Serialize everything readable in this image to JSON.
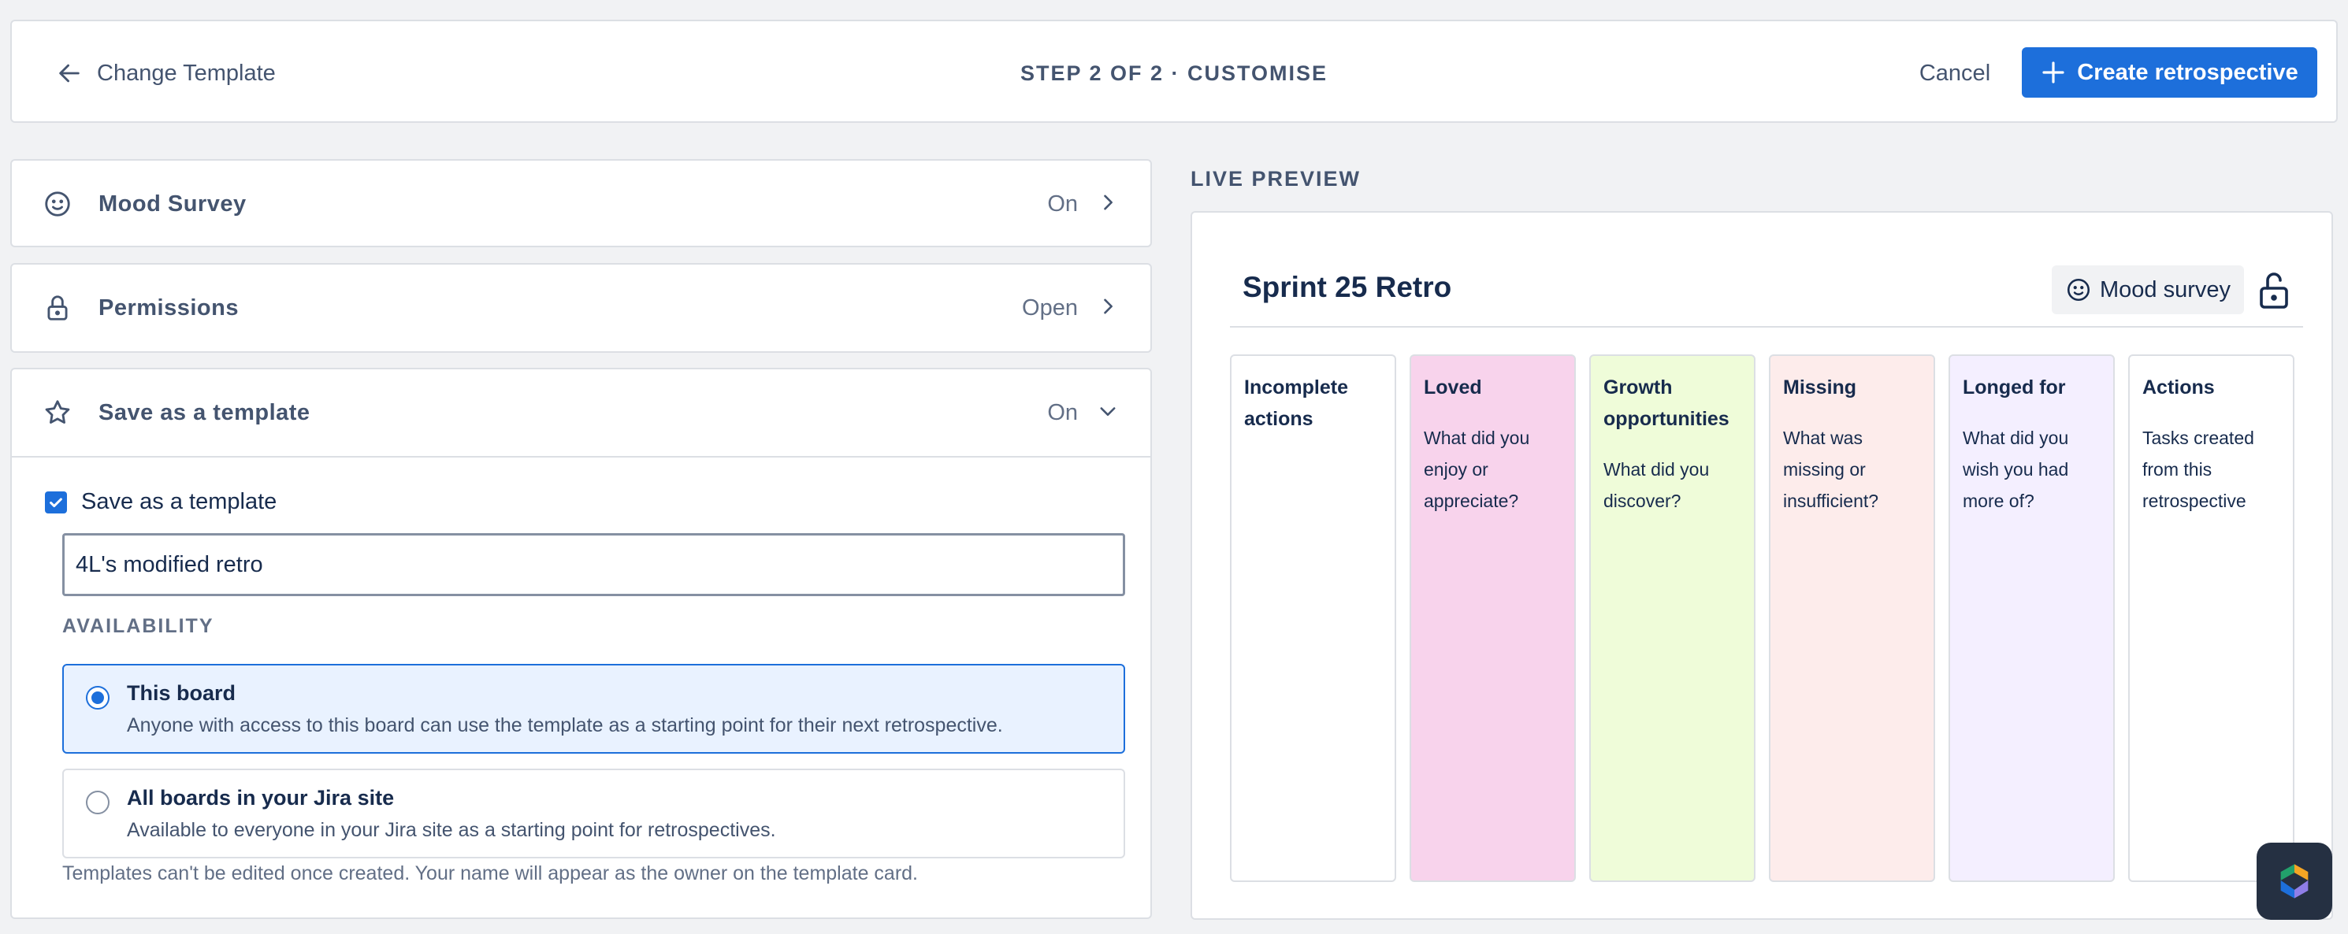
{
  "header": {
    "back_label": "Change Template",
    "step_title": "STEP 2 OF 2 · CUSTOMISE",
    "cancel_label": "Cancel",
    "create_label": "Create retrospective"
  },
  "settings": {
    "mood_survey": {
      "label": "Mood Survey",
      "value": "On",
      "icon": "smile-icon"
    },
    "permissions": {
      "label": "Permissions",
      "value": "Open",
      "icon": "lock-icon"
    },
    "save_template": {
      "label": "Save as a template",
      "value": "On",
      "icon": "star-icon",
      "checkbox_label": "Save as a template",
      "checked": true,
      "template_name": "4L's modified retro",
      "availability_label": "AVAILABILITY",
      "options": [
        {
          "title": "This board",
          "description": "Anyone with access to this board can use the template as a starting point for their next retrospective.",
          "selected": true
        },
        {
          "title": "All boards in your Jira site",
          "description": "Available to everyone in your Jira site as a starting point for retrospectives.",
          "selected": false
        }
      ],
      "footnote": "Templates can't be edited once created. Your name will appear as the owner on the template card."
    }
  },
  "preview": {
    "label": "LIVE PREVIEW",
    "board_title": "Sprint 25 Retro",
    "mood_chip": "Mood survey",
    "columns": [
      {
        "title": "Incomplete actions",
        "description": "",
        "color": "#ffffff"
      },
      {
        "title": "Loved",
        "description": "What did you enjoy or appreciate?",
        "color": "#f8d3ec"
      },
      {
        "title": "Growth opportunities",
        "description": "What did you discover?",
        "color": "#effcd9"
      },
      {
        "title": "Missing",
        "description": "What was missing or insufficient?",
        "color": "#fdeceb"
      },
      {
        "title": "Longed for",
        "description": "What did you wish you had more of?",
        "color": "#f4efff"
      },
      {
        "title": "Actions",
        "description": "Tasks created from this retrospective",
        "color": "#ffffff"
      }
    ]
  },
  "colors": {
    "primary": "#1d6fdb",
    "border": "#dcdfe4",
    "background": "#f1f2f4"
  }
}
